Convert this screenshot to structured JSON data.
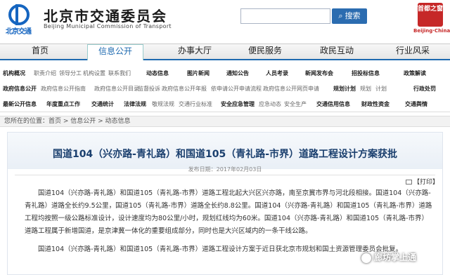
{
  "header": {
    "logo_text": "北京交通",
    "title": "北京市交通委员会",
    "subtitle": "Beijing Municipal Commission of Transport",
    "search_button": "搜索",
    "seal_text": "首都之窗",
    "seal_sub": "Beijing·China"
  },
  "nav": [
    "首页",
    "信息公开",
    "办事大厅",
    "便民服务",
    "政民互动",
    "行业风采"
  ],
  "subnav": {
    "row1": [
      "机构概况",
      "职责介绍",
      "领导分工",
      "机构设置",
      "联系我们",
      "动态信息",
      "图片新闻",
      "通知公告",
      "人员考录",
      "新闻发布会",
      "招投标信息",
      "政策解读"
    ],
    "row2": [
      "政府信息公开",
      "政府信息公开指南",
      "政府信息公开目录",
      "监督投诉",
      "政府信息公开年报",
      "依申请公开申请流程",
      "政府信息公开网页申请",
      "规划计划",
      "规划",
      "计划",
      "行政处罚"
    ],
    "row3": [
      "最新公开信息",
      "年度重点工作",
      "交通统计",
      "法律法规",
      "敬规法规",
      "交通行业标准",
      "安全应急管理",
      "应急动态",
      "安全生产",
      "交通信用信息",
      "财政性资金",
      "交通舆情"
    ]
  },
  "breadcrumb": "您所在的位置：首页 > 信息公开 > 动态信息",
  "article": {
    "title": "国道104（兴亦路-青礼路）和国道105（青礼路-市界）道路工程设计方案获批",
    "date": "发布日期：2017年02月03日",
    "print": "【打印】",
    "p1": "国道104（兴亦路-青礼路）和国道105（青礼路-市界）道路工程北起大兴区兴亦路，南至京冀市界与河北段相接。国道104（兴亦路-青礼路）道路全长约9.5公里，国道105（青礼路-市界）道路全长约8.8公里。国道104（兴亦路-青礼路）和国道105（青礼路-市界）道路工程均按照一级公路标准设计，设计速度均为80公里/小时，规划红线均为60米。国道104（兴亦路-青礼路）和国道105（青礼路-市界）道路工程属于新增国道，是京津冀一体化的重要组成部分，同时也是大兴区域内的一条干线公路。",
    "p2": "国道104（兴亦路-青礼路）和国道105（青礼路-市界）道路工程设计方案于近日获北京市规划和国土资源管理委员会批复。"
  },
  "watermark": "廊坊掌上通"
}
